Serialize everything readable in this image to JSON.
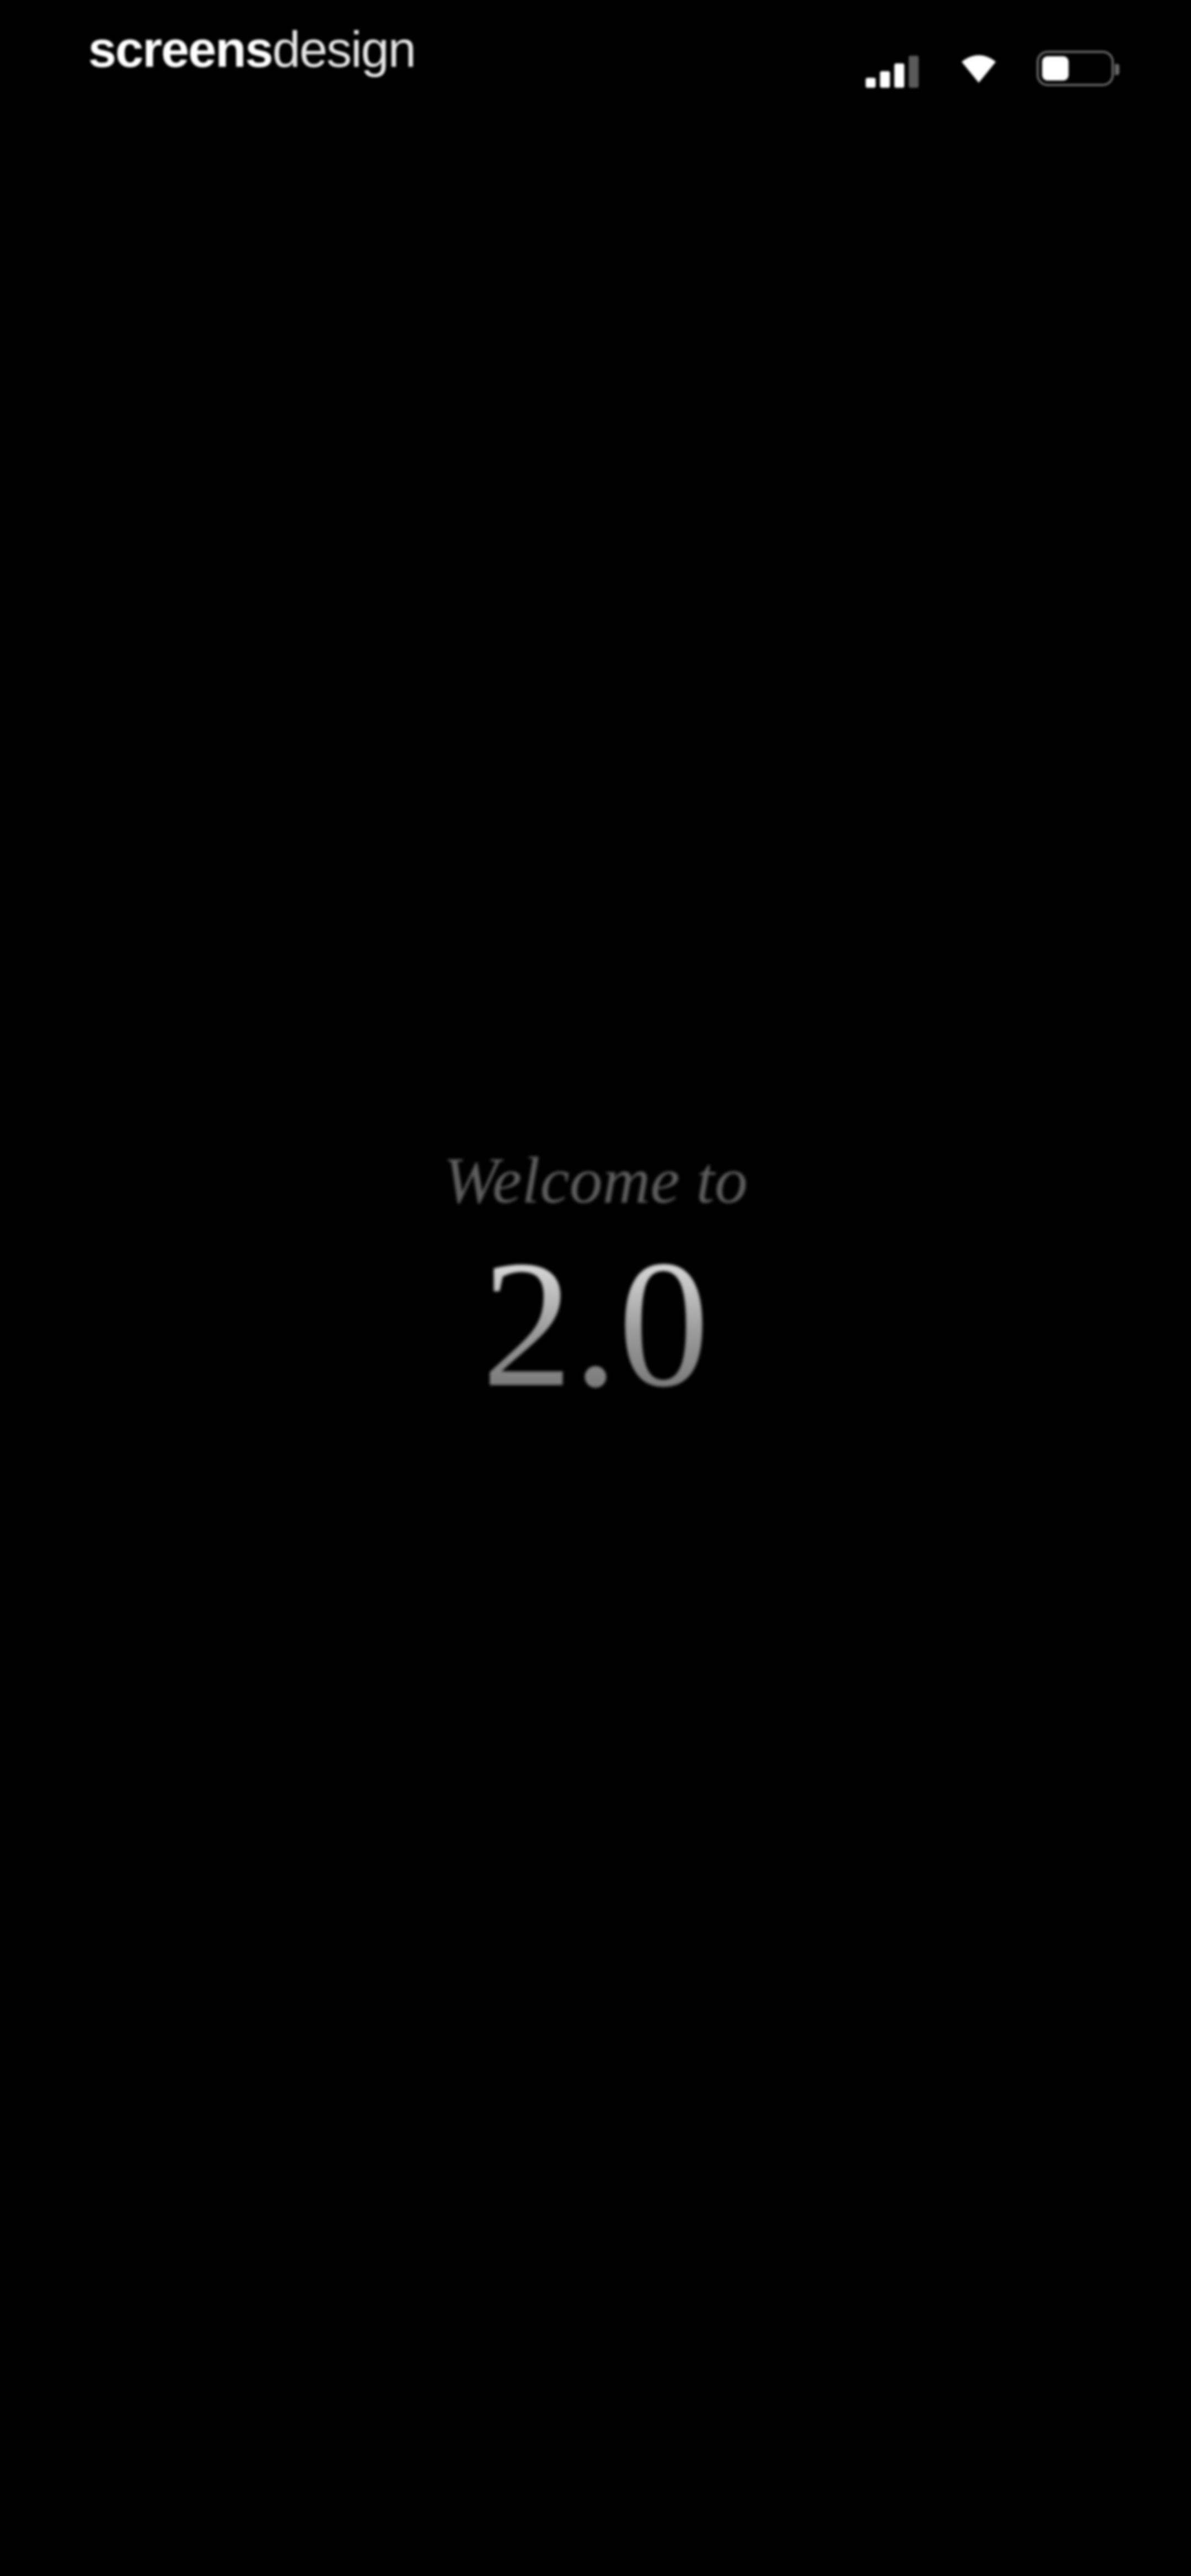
{
  "status_bar": {
    "brand": {
      "bold": "screens",
      "light": "design"
    },
    "signal_icon": "cellular-signal-icon",
    "signal_strength": 3,
    "signal_max": 4,
    "wifi_icon": "wifi-icon",
    "battery_icon": "battery-icon",
    "battery_level": 0.4
  },
  "welcome": {
    "line": "Welcome to",
    "version": "2.0"
  },
  "colors": {
    "background": "#000000",
    "text_primary": "#ffffff",
    "welcome_text": "#5e5e5e"
  }
}
